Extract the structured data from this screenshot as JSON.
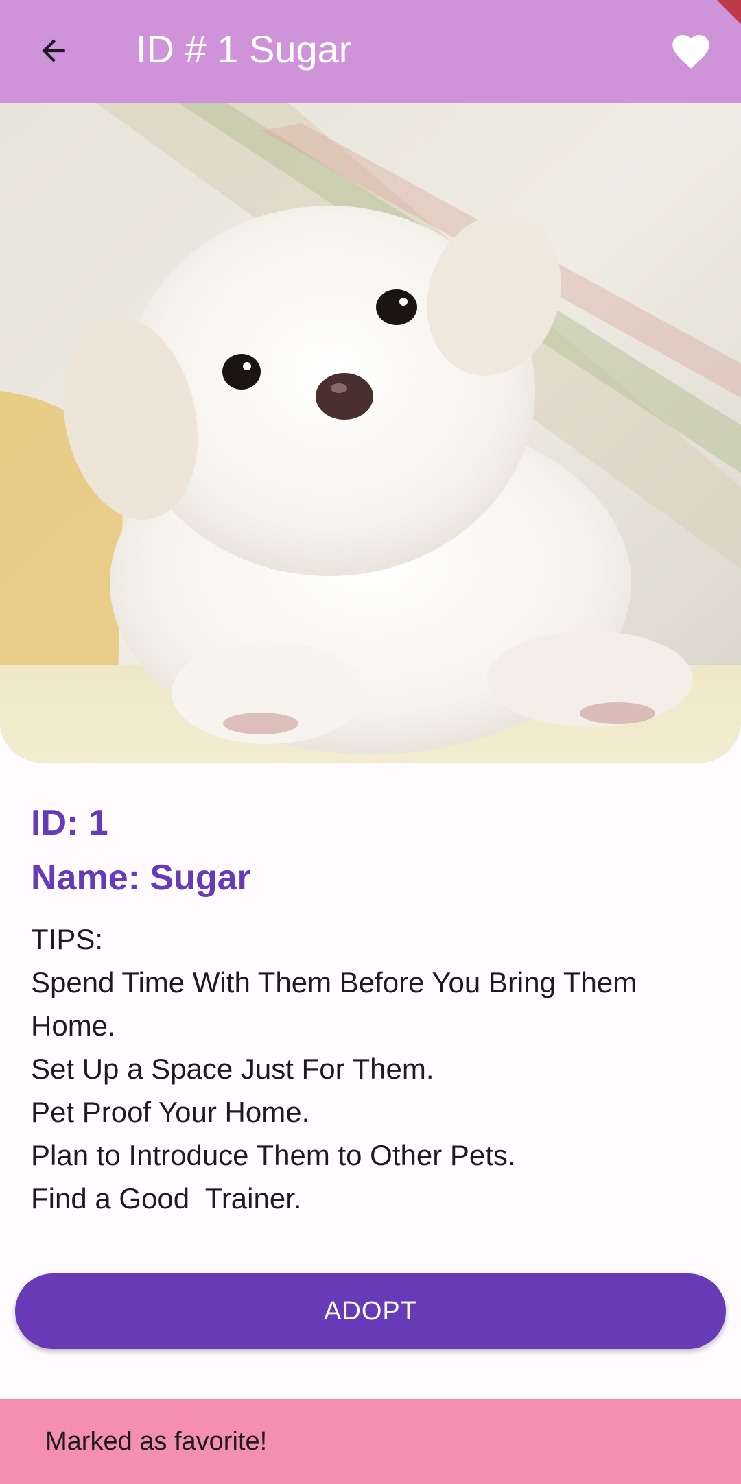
{
  "app_bar": {
    "title": "ID # 1 Sugar",
    "back_icon": "arrow-back-icon",
    "favorite_icon": "heart-icon",
    "background": "#ce93d8"
  },
  "hero_image": {
    "subject": "white puppy photo"
  },
  "pet": {
    "id_line": "ID: 1",
    "name_line": "Name: Sugar"
  },
  "tips": [
    "TIPS:",
    "Spend Time With Them Before You Bring Them",
    "Home.",
    "Set Up a Space Just For Them.",
    "Pet Proof Your Home.",
    "Plan to Introduce Them to Other Pets.",
    "Find a Good  Trainer."
  ],
  "adopt_button": {
    "label": "ADOPT",
    "color": "#673ab7"
  },
  "snackbar": {
    "message": "Marked as favorite!",
    "background": "#f48fb1"
  },
  "colors": {
    "accent": "#673ab7",
    "app_bar": "#ce93d8",
    "page_background": "#fffbfe"
  }
}
